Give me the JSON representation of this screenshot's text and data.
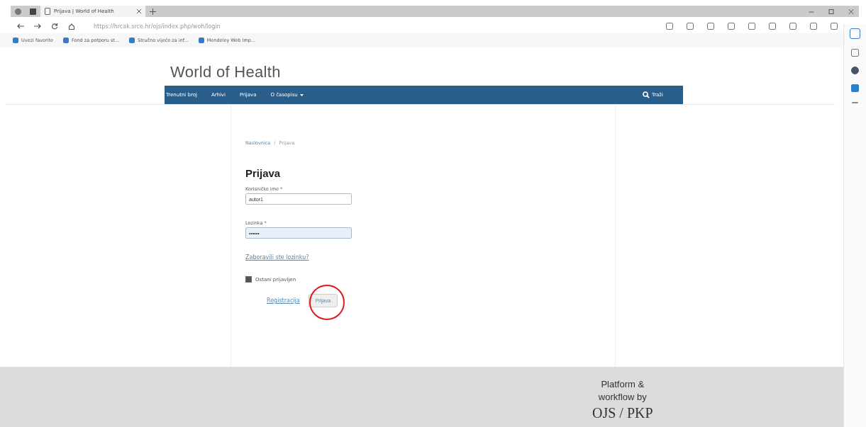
{
  "browser": {
    "tab_title": "Prijava | World of Health",
    "url": "https://hrcak.srce.hr/ojs/index.php/woh/login",
    "bookmarks": [
      "Uvezi favorite",
      "Fond za potporu st...",
      "Stručno vijeće za inf...",
      "Mendeley Web Imp..."
    ]
  },
  "site_title": "World of Health",
  "nav": [
    {
      "label": "Trenutni broj",
      "dropdown": false
    },
    {
      "label": "Arhivi",
      "dropdown": false
    },
    {
      "label": "Prijava",
      "dropdown": false
    },
    {
      "label": "O časopisu",
      "dropdown": true
    }
  ],
  "search_label": "Traži",
  "breadcrumb": [
    "Naslovnica",
    "Prijava"
  ],
  "breadcrumb_separator": "/",
  "heading": "Prijava",
  "fields": [
    {
      "label": "Korisničko ime *",
      "value": "autor1",
      "focused": false
    },
    {
      "label": "Lozinka *",
      "value": "••••••",
      "focused": true
    }
  ],
  "forgot_link": "Zaboravili ste lozinku?",
  "remember": {
    "label": "Ostani prijavljen",
    "checked": true
  },
  "register_link": "Registracija",
  "submit": "Prijava",
  "footer": {
    "line1": "Platform &",
    "line2": "workflow by",
    "logo": "OJS / PKP"
  }
}
